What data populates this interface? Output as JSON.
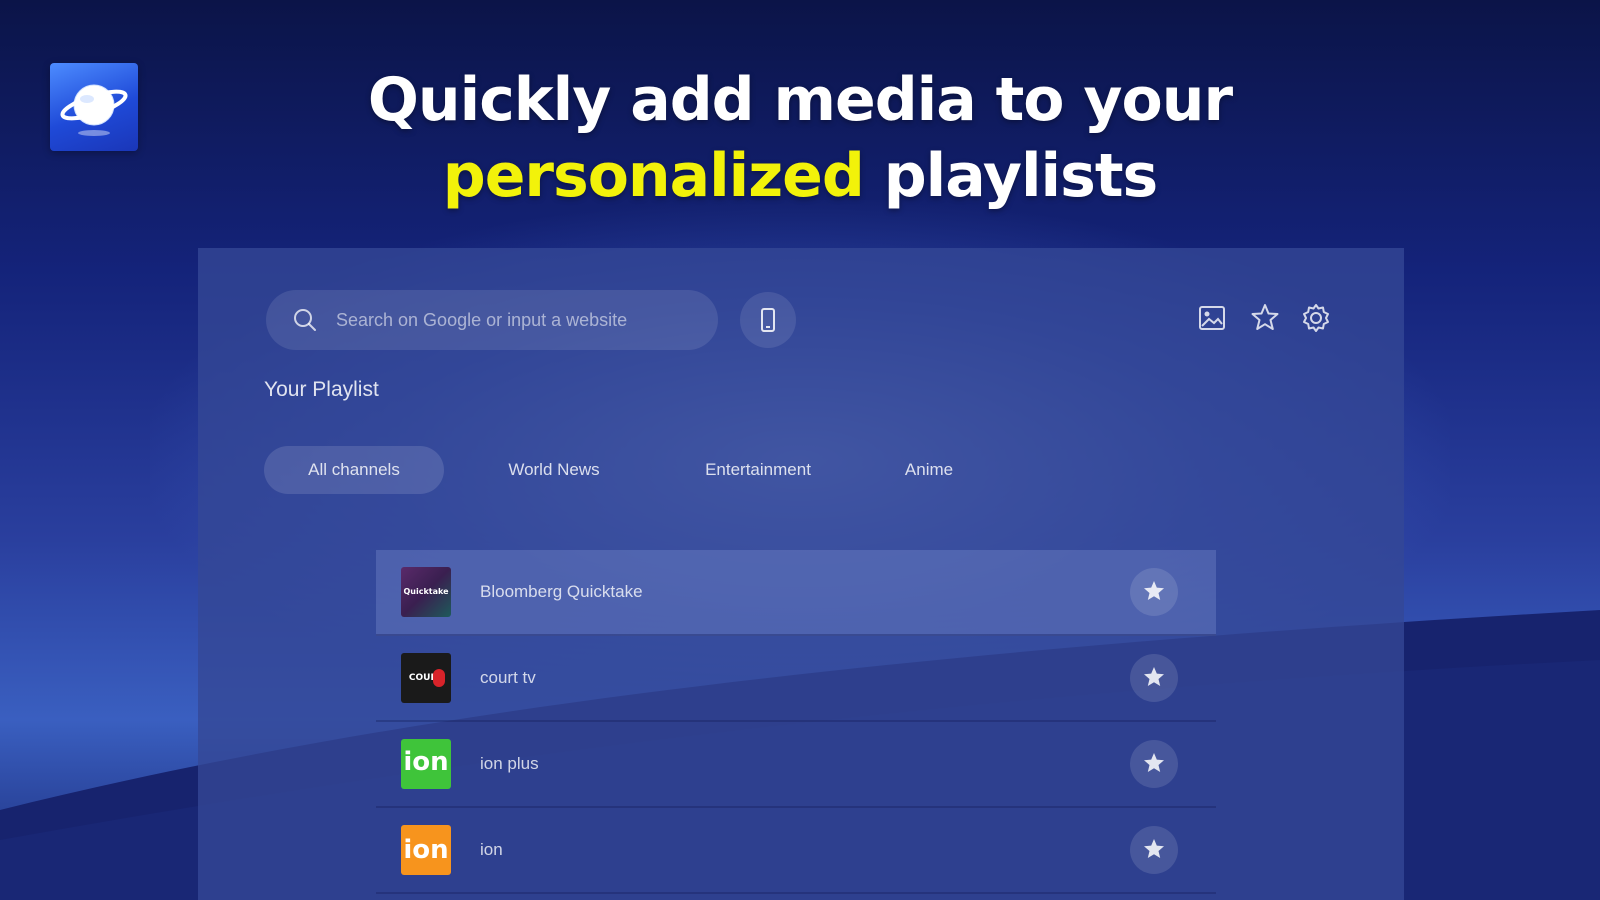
{
  "headline": {
    "line1": "Quickly add media to your",
    "accent": "personalized",
    "line2_rest": " playlists"
  },
  "search": {
    "placeholder": "Search on Google or input a website"
  },
  "toolbar": {
    "icons": [
      "image-icon",
      "star-outline-icon",
      "gear-icon"
    ]
  },
  "playlist": {
    "title": "Your Playlist",
    "tabs": [
      {
        "label": "All channels",
        "active": true
      },
      {
        "label": "World News",
        "active": false
      },
      {
        "label": "Entertainment",
        "active": false
      },
      {
        "label": "Anime",
        "active": false
      }
    ],
    "channels": [
      {
        "name": "Bloomberg Quicktake",
        "logo_text": "Quicktake"
      },
      {
        "name": "court tv",
        "logo_text": "COURT"
      },
      {
        "name": "ion plus",
        "logo_text": "ion"
      },
      {
        "name": "ion",
        "logo_text": "ion"
      }
    ]
  },
  "colors": {
    "accent_yellow": "#f2f20a",
    "ion_plus_green": "#3fc43a",
    "ion_orange": "#f7941d"
  }
}
